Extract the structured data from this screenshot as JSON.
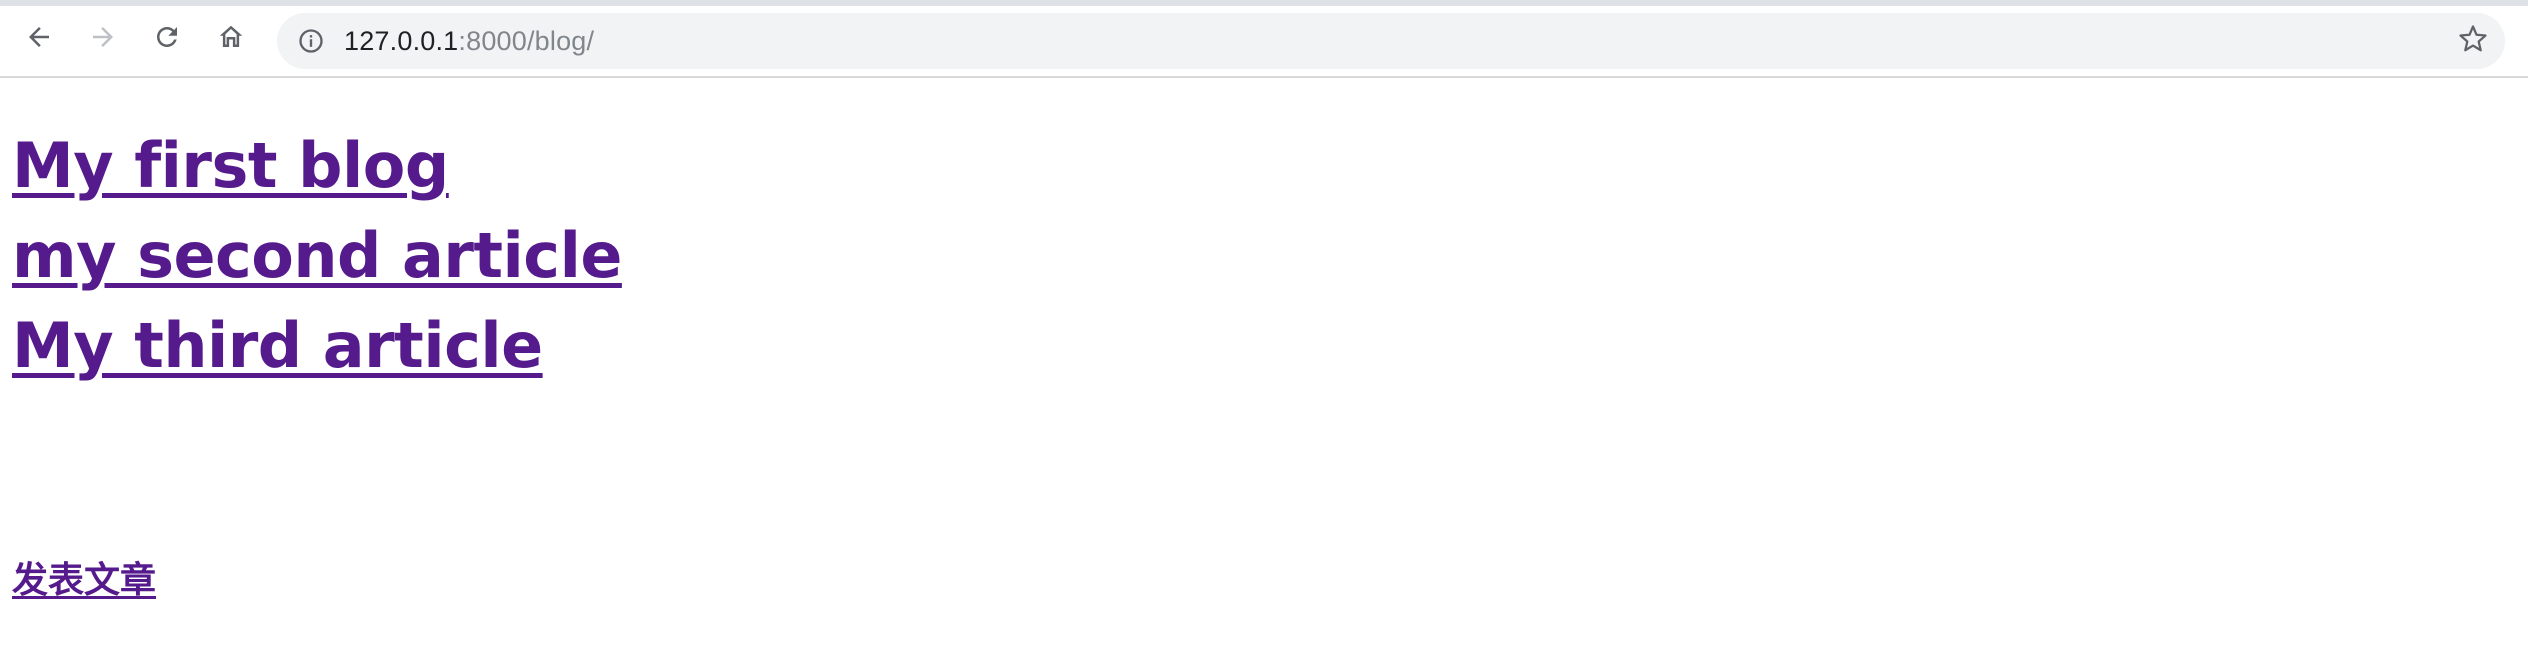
{
  "browser": {
    "url_host": "127.0.0.1",
    "url_rest": ":8000/blog/",
    "icons": {
      "back": "arrow-left-icon",
      "forward": "arrow-right-icon",
      "reload": "reload-icon",
      "home": "home-icon",
      "info": "info-icon",
      "bookmark": "star-icon"
    },
    "colors": {
      "toolbar_bg": "#ffffff",
      "omnibox_bg": "#f1f3f4",
      "icon_active": "#5f6368",
      "icon_disabled": "#bdc1c6"
    }
  },
  "page": {
    "articles": [
      {
        "title": "My first blog"
      },
      {
        "title": "my second article"
      },
      {
        "title": "My third article"
      }
    ],
    "publish_link": "发表文章",
    "colors": {
      "visited_link": "#551a8b",
      "background": "#ffffff"
    }
  }
}
